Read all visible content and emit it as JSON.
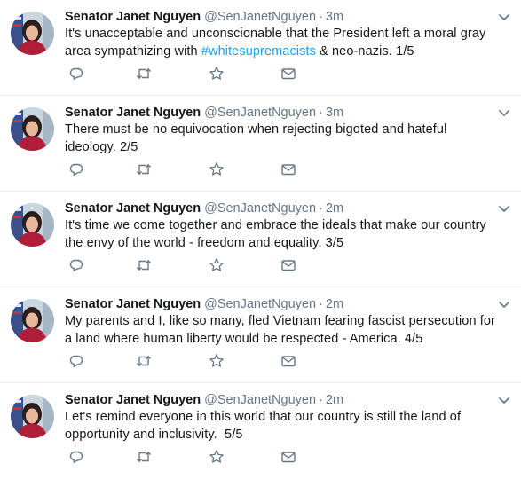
{
  "colors": {
    "text": "#14171a",
    "muted": "#657786",
    "link": "#1da1f2",
    "divider": "#e6ecf0"
  },
  "icons": [
    "avatar",
    "reply-icon",
    "retweet-icon",
    "like-star-icon",
    "direct-message-icon",
    "chevron-down-icon"
  ],
  "tweets": [
    {
      "name": "Senator Janet Nguyen",
      "handle": "@SenJanetNguyen",
      "dot": "·",
      "time": "3m",
      "text_before": "It's unacceptable and unconscionable that the President left a moral gray area sympathizing with ",
      "hashtag": "#whitesupremacists",
      "text_after": " & neo-nazis. 1/5"
    },
    {
      "name": "Senator Janet Nguyen",
      "handle": "@SenJanetNguyen",
      "dot": "·",
      "time": "3m",
      "text_before": "There must be no equivocation when rejecting bigoted and hateful ideology. 2/5",
      "hashtag": "",
      "text_after": ""
    },
    {
      "name": "Senator Janet Nguyen",
      "handle": "@SenJanetNguyen",
      "dot": "·",
      "time": "2m",
      "text_before": "It's time we come together and embrace the ideals that make our country the envy of the world - freedom and equality. 3/5",
      "hashtag": "",
      "text_after": ""
    },
    {
      "name": "Senator Janet Nguyen",
      "handle": "@SenJanetNguyen",
      "dot": "·",
      "time": "2m",
      "text_before": "My parents and I, like so many, fled Vietnam fearing fascist persecution for a land where human liberty would be respected - America. 4/5",
      "hashtag": "",
      "text_after": ""
    },
    {
      "name": "Senator Janet Nguyen",
      "handle": "@SenJanetNguyen",
      "dot": "·",
      "time": "2m",
      "text_before": "Let's remind everyone in this world that our country is still the land of opportunity and inclusivity.  5/5",
      "hashtag": "",
      "text_after": ""
    }
  ]
}
